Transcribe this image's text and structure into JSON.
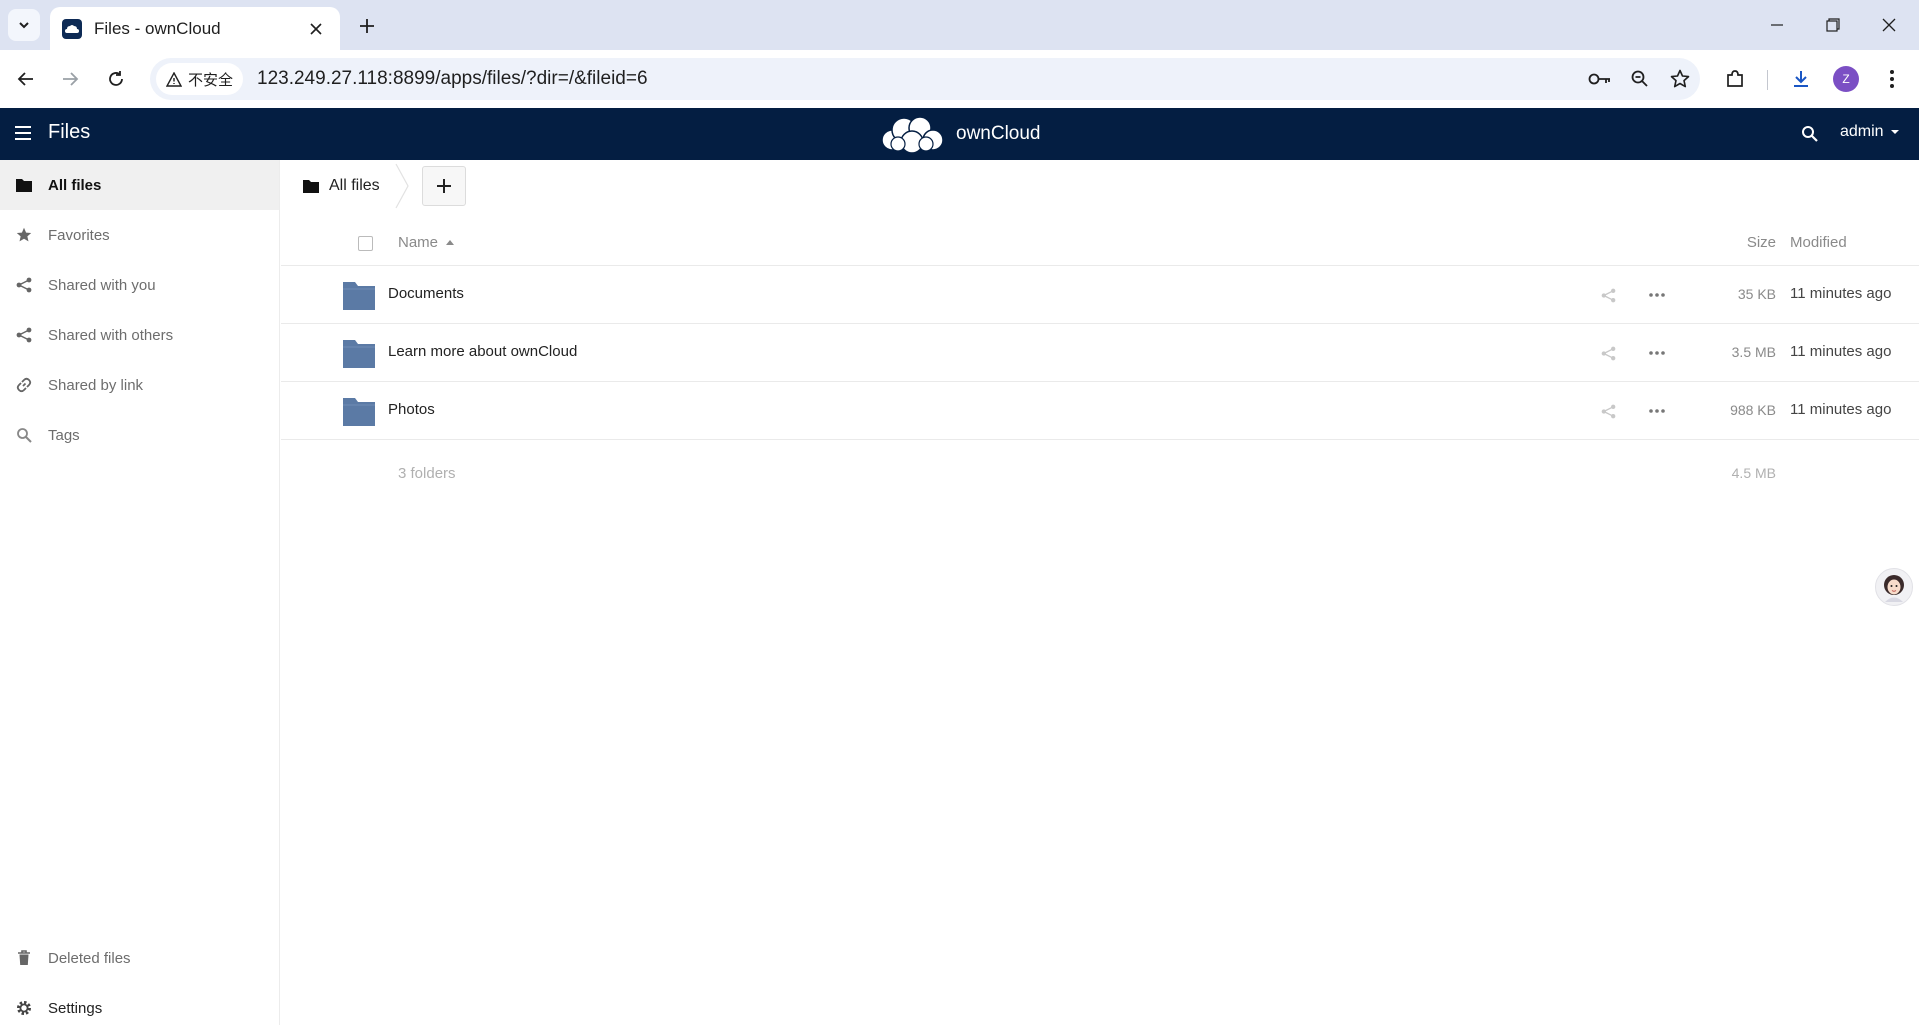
{
  "browser": {
    "tab_title": "Files - ownCloud",
    "security_label": "不安全",
    "url": "123.249.27.118:8899/apps/files/?dir=/&fileid=6",
    "profile_initial": "Z"
  },
  "header": {
    "app_name": "Files",
    "logo_text": "ownCloud",
    "user": "admin"
  },
  "sidebar": {
    "items": [
      {
        "label": "All files",
        "icon": "folder-icon"
      },
      {
        "label": "Favorites",
        "icon": "star-icon"
      },
      {
        "label": "Shared with you",
        "icon": "share-icon"
      },
      {
        "label": "Shared with others",
        "icon": "share-icon"
      },
      {
        "label": "Shared by link",
        "icon": "link-icon"
      },
      {
        "label": "Tags",
        "icon": "tag-search-icon"
      }
    ],
    "deleted_files": "Deleted files",
    "settings": "Settings"
  },
  "breadcrumb": {
    "home": "All files"
  },
  "table": {
    "columns": {
      "name": "Name",
      "size": "Size",
      "modified": "Modified"
    },
    "rows": [
      {
        "name": "Documents",
        "size": "35 KB",
        "modified": "11 minutes ago"
      },
      {
        "name": "Learn more about ownCloud",
        "size": "3.5 MB",
        "modified": "11 minutes ago"
      },
      {
        "name": "Photos",
        "size": "988 KB",
        "modified": "11 minutes ago"
      }
    ],
    "summary": {
      "count": "3 folders",
      "size": "4.5 MB"
    }
  },
  "colors": {
    "header_bg": "#041e42",
    "folder": "#5b7aa5"
  }
}
